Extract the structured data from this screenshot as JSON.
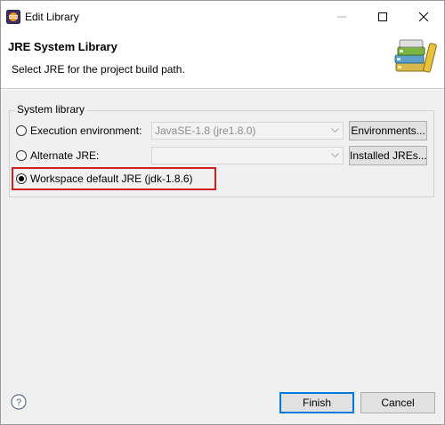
{
  "window": {
    "title": "Edit Library"
  },
  "header": {
    "title": "JRE System Library",
    "description": "Select JRE for the project build path."
  },
  "system_library": {
    "group_label": "System library",
    "options": [
      {
        "label": "Execution environment:",
        "selected": false,
        "combo_value": "JavaSE-1.8 (jre1.8.0)",
        "combo_enabled": false,
        "button_label": "Environments..."
      },
      {
        "label": "Alternate JRE:",
        "selected": false,
        "combo_value": "",
        "combo_enabled": false,
        "button_label": "Installed JREs..."
      },
      {
        "label": "Workspace default JRE (jdk-1.8.6)",
        "selected": true,
        "highlighted": true,
        "highlight_color": "#d0201e"
      }
    ]
  },
  "footer": {
    "finish_label": "Finish",
    "cancel_label": "Cancel"
  },
  "icons": {
    "app": "eclipse-icon",
    "header": "library-books-icon",
    "help": "help-icon",
    "minimize": "minimize-icon",
    "maximize": "maximize-icon",
    "close": "close-icon"
  },
  "colors": {
    "default_button_border": "#0078d7",
    "highlight": "#d0201e"
  }
}
